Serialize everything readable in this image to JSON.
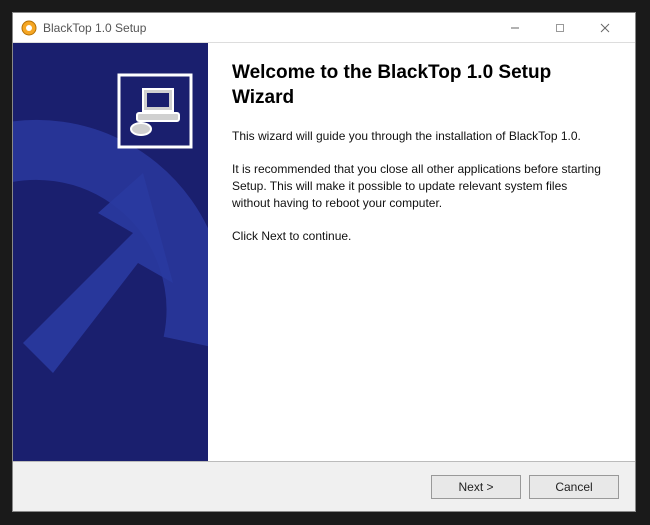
{
  "titlebar": {
    "title": "BlackTop 1.0 Setup"
  },
  "main": {
    "heading": "Welcome to the BlackTop 1.0 Setup Wizard",
    "para1": "This wizard will guide you through the installation of BlackTop 1.0.",
    "para2": "It is recommended that you close all other applications before starting Setup. This will make it possible to update relevant system files without having to reboot your computer.",
    "para3": "Click Next to continue."
  },
  "footer": {
    "next": "Next >",
    "cancel": "Cancel"
  }
}
